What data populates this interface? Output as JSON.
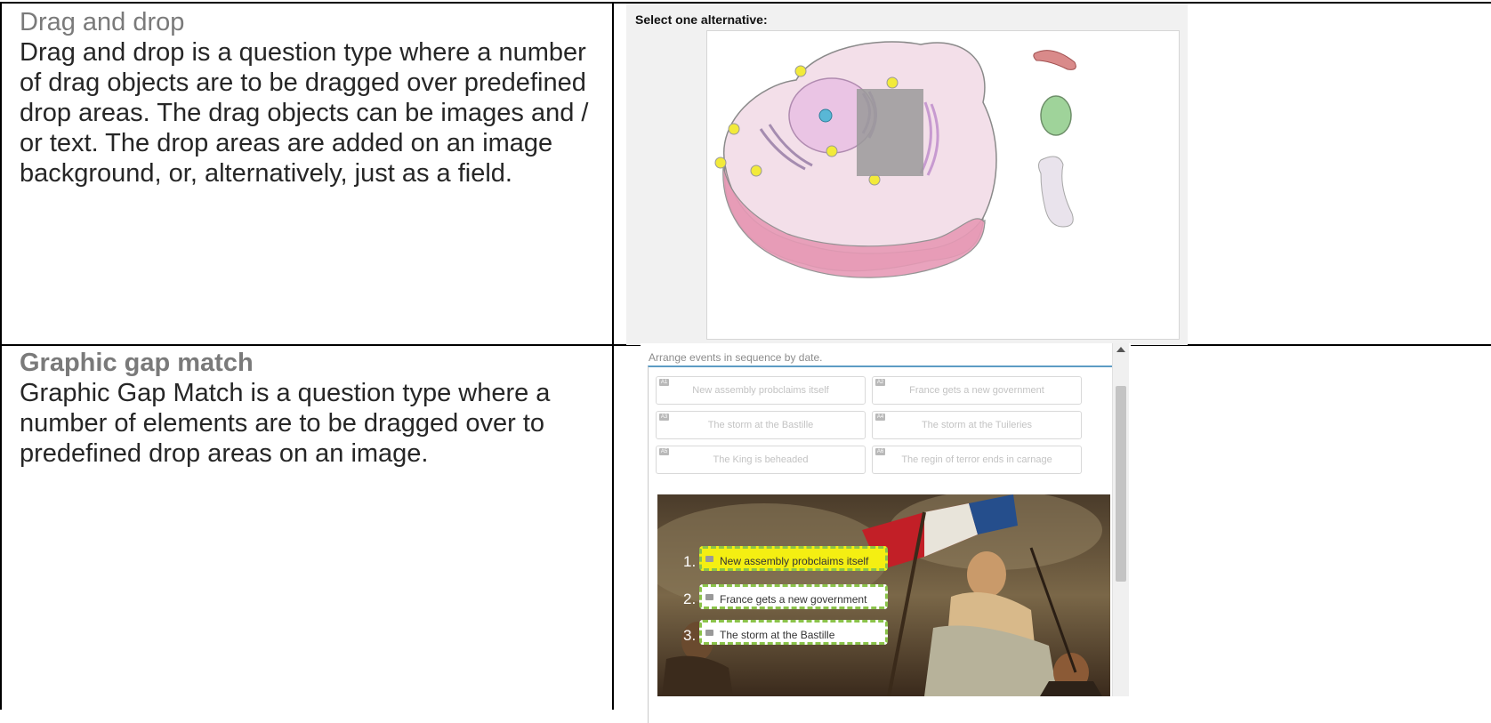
{
  "rows": [
    {
      "heading": "Drag and drop",
      "body": "Drag and drop is a question type where a number of drag objects are to be dragged over predefined drop areas. The drag objects can be images and / or text. The drop areas are added on an image background, or, alternatively, just as a field."
    },
    {
      "heading": "Graphic gap match",
      "body": "Graphic Gap Match is a question type where a number of elements are to be dragged over to predefined drop areas on an image."
    }
  ],
  "drag_drop_panel": {
    "prompt": "Select one alternative:"
  },
  "gap_match_panel": {
    "prompt": "Arrange events in sequence by date.",
    "choices": [
      {
        "tag": "A1",
        "label": "New assembly probclaims itself"
      },
      {
        "tag": "A2",
        "label": "France gets a new government"
      },
      {
        "tag": "A3",
        "label": "The storm at the Bastille"
      },
      {
        "tag": "A4",
        "label": "The storm at the Tuileries"
      },
      {
        "tag": "A5",
        "label": "The King is beheaded"
      },
      {
        "tag": "A6",
        "label": "The regin of terror ends in carnage"
      }
    ],
    "drops": [
      {
        "number": "1.",
        "label": "New assembly probclaims itself"
      },
      {
        "number": "2.",
        "label": "France gets a new government"
      },
      {
        "number": "3.",
        "label": "The storm at the Bastille"
      }
    ]
  },
  "colors": {
    "grid": "#000000",
    "heading": "#7a7a7a",
    "body": "#262626",
    "drop_border": "#8bc34a",
    "drop_highlight": "#f4ef12",
    "focus_border": "#5d9cc4"
  },
  "icons": [
    "scroll-up-arrow-icon",
    "choice-tag-icon"
  ]
}
